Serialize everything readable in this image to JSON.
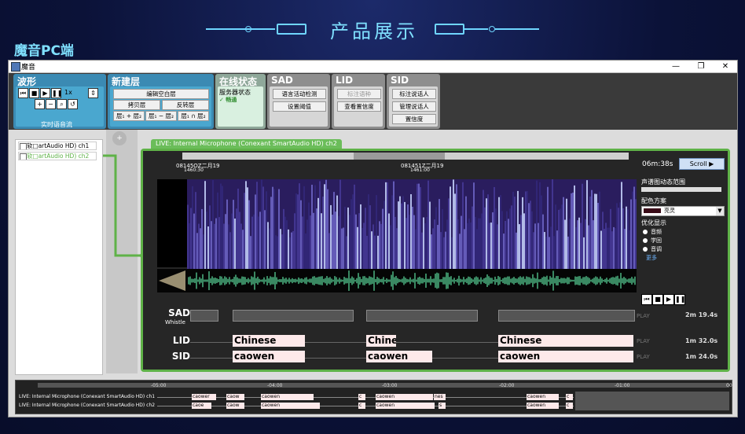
{
  "banner": {
    "title": "产品展示"
  },
  "page": {
    "subtitle": "魔音PC端"
  },
  "window": {
    "title": "魔音",
    "min": "—",
    "max": "❐",
    "close": "✕"
  },
  "toolbar": {
    "waveform": {
      "title": "波形",
      "speed": "1x",
      "stream_label": "实时语音流"
    },
    "newlayer": {
      "title": "新建层",
      "edit_blank": "编辑空白层",
      "copy_layer": "拷贝层",
      "invert_layer": "反转层",
      "op_add": "层₁ + 层₂",
      "op_sub": "层₁ − 层₂",
      "op_and": "层₁ ∩ 层₂"
    },
    "online": {
      "title": "在线状态",
      "server_status": "服务器状态",
      "status_value": "✓ 畅通"
    },
    "sad": {
      "title": "SAD",
      "vad": "语言活动检测",
      "threshold": "设置阈值"
    },
    "lid": {
      "title": "LID",
      "mark_lang": "标注语种",
      "view_conf": "查看置信度"
    },
    "sid": {
      "title": "SID",
      "mark_speaker": "标注说话人",
      "manage_speaker": "管理说话人",
      "confidence": "置信度"
    }
  },
  "channels": [
    {
      "label": "软□artAudio HD) ch1",
      "checked": false
    },
    {
      "label": "软□artAudio HD) ch2",
      "checked": true
    }
  ],
  "main": {
    "tab": "LIVE: Internal Microphone (Conexant SmartAudio HD) ch2",
    "time1": "08145OZ二月19",
    "time1b": "1460:30",
    "time2": "081451Z二月19",
    "time2b": "1461:00",
    "elapsed": "06m:38s",
    "scroll": "Scroll ▶",
    "dyn_range": "声谱图动态范围",
    "color_scheme": "配色方案",
    "color_value": "亮灵",
    "optimize": "优化显示",
    "opt1": "音频",
    "opt2": "学回",
    "opt3": "音调",
    "more": "更多",
    "rows": {
      "sad": {
        "label": "SAD",
        "sub": "Whistle",
        "play": "PLAY",
        "dur": "2m 19.4s"
      },
      "lid": {
        "label": "LID",
        "segs": [
          "Chinese",
          "Chine",
          "Chinese"
        ],
        "play": "PLAY",
        "dur": "1m 32.0s"
      },
      "sid": {
        "label": "SID",
        "segs": [
          "caowen",
          "caowen",
          "caowen"
        ],
        "play": "PLAY",
        "dur": "1m 24.0s"
      }
    }
  },
  "bottom": {
    "ticks": [
      "-05:00",
      "-04:00",
      "-03:00",
      "-02:00",
      "-01:00",
      "00"
    ],
    "row1": "LIVE: Internal Microphone (Conexant SmartAudio HD) ch1",
    "row2": "LIVE: Internal Microphone (Conexant SmartAudio HD) ch2",
    "segs_r1": [
      "caower",
      "caow",
      "caowen",
      "c",
      "caowen",
      "nes",
      "caowen",
      "c"
    ],
    "segs_r2": [
      "caoe",
      "caow",
      "caowen",
      "c",
      "caowen",
      "s",
      "caowen",
      "c"
    ]
  },
  "colors": {
    "accent": "#7fe0ff",
    "panel_green": "#5fb248",
    "tool_blue": "#4aa7cf"
  }
}
